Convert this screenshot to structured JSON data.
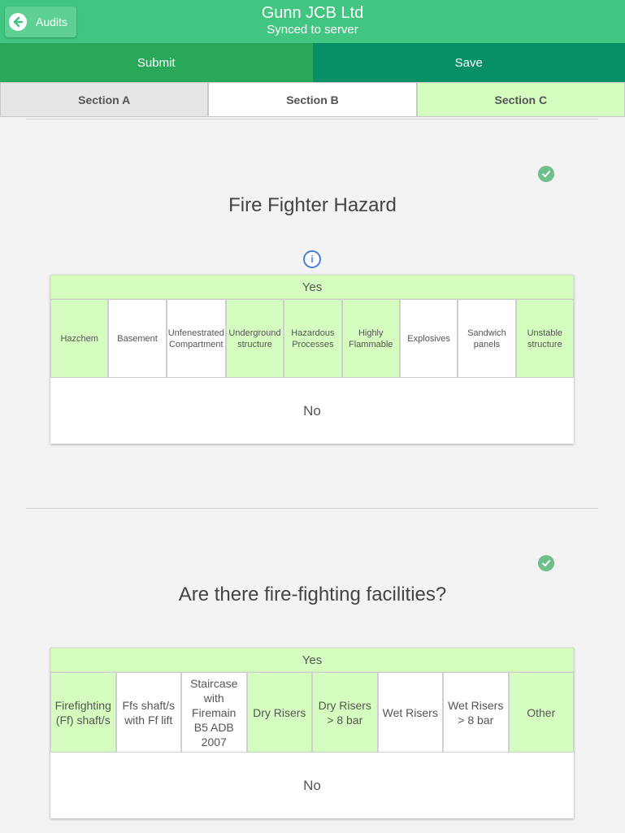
{
  "header": {
    "back_label": "Audits",
    "title": "Gunn JCB Ltd",
    "subtitle": "Synced to server"
  },
  "actions": {
    "submit": "Submit",
    "save": "Save"
  },
  "tabs": [
    "Section A",
    "Section B",
    "Section C"
  ],
  "questions": [
    {
      "title": "Fire Fighter Hazard",
      "yes": "Yes",
      "no": "No",
      "options": [
        {
          "label": "Hazchem",
          "selected": true
        },
        {
          "label": "Basement",
          "selected": false
        },
        {
          "label": "Unfenestrated Compartment",
          "selected": false
        },
        {
          "label": "Underground structure",
          "selected": true
        },
        {
          "label": "Hazardous Processes",
          "selected": true
        },
        {
          "label": "Highly Flammable",
          "selected": true
        },
        {
          "label": "Explosives",
          "selected": false
        },
        {
          "label": "Sandwich panels",
          "selected": false
        },
        {
          "label": "Unstable structure",
          "selected": true
        }
      ]
    },
    {
      "title": "Are there fire-fighting facilities?",
      "yes": "Yes",
      "no": "No",
      "options": [
        {
          "label": "Firefighting (Ff) shaft/s",
          "selected": true
        },
        {
          "label": "Ffs shaft/s with Ff lift",
          "selected": false
        },
        {
          "label": "Staircase with Firemain B5 ADB 2007",
          "selected": false
        },
        {
          "label": "Dry Risers",
          "selected": true
        },
        {
          "label": "Dry Risers > 8 bar",
          "selected": true
        },
        {
          "label": "Wet Risers",
          "selected": false
        },
        {
          "label": "Wet Risers > 8 bar",
          "selected": false
        },
        {
          "label": "Other",
          "selected": true
        }
      ]
    }
  ],
  "colors": {
    "header": "#41c580",
    "submit": "#2aa85a",
    "save": "#078f67",
    "selected": "#d6fdc0"
  }
}
